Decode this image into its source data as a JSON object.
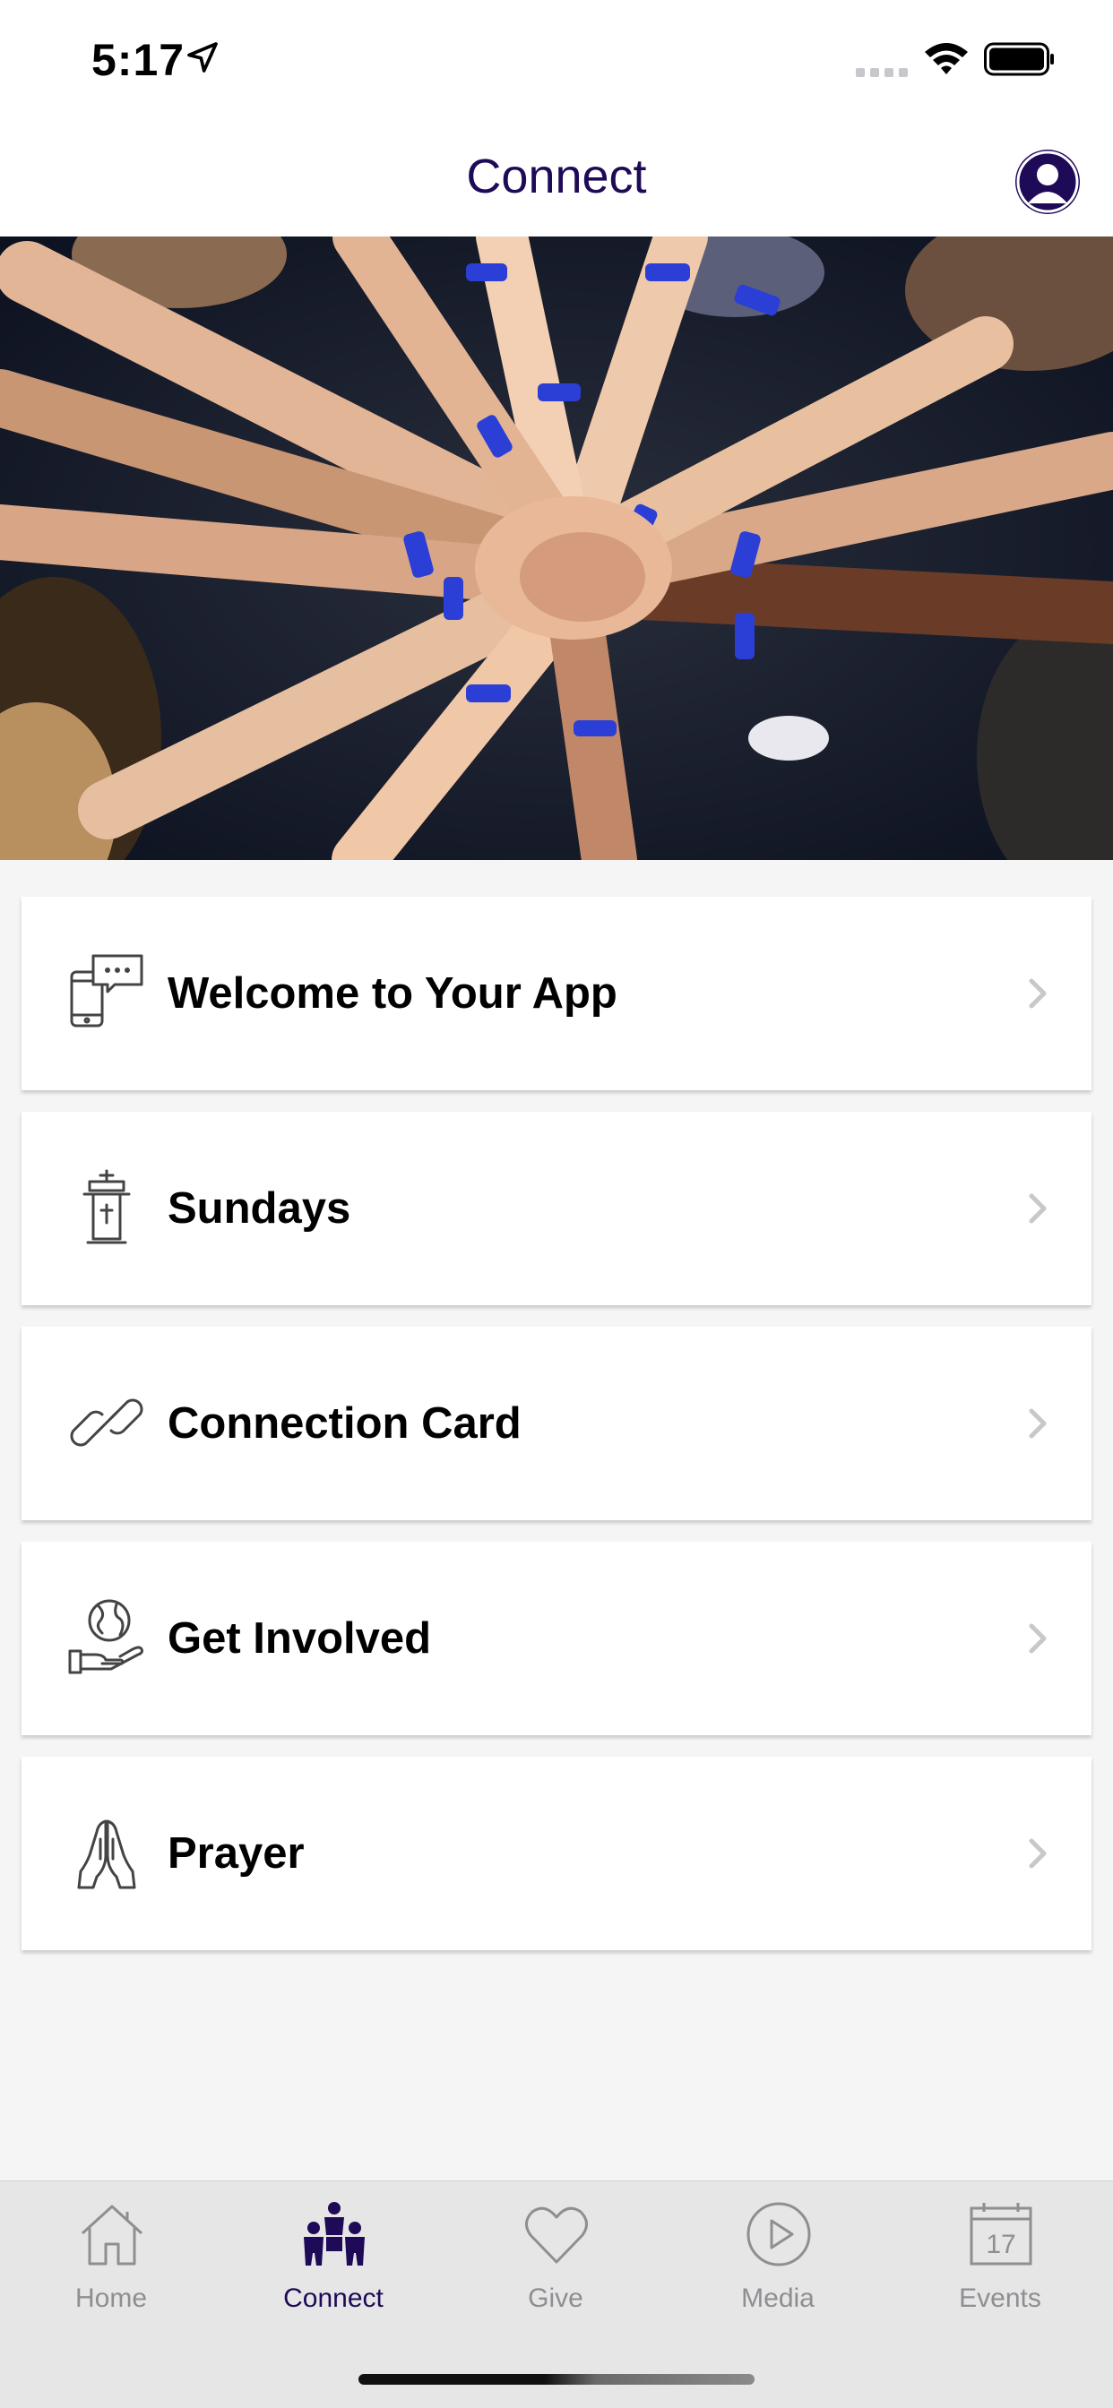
{
  "status_bar": {
    "time": "5:17",
    "icons": [
      "location-arrow-icon",
      "cellular-signal-icon",
      "wifi-icon",
      "battery-icon"
    ]
  },
  "header": {
    "title": "Connect",
    "profile_icon": "user-profile-icon"
  },
  "hero": {
    "image": "team-hands-stacked-photo"
  },
  "menu": {
    "items": [
      {
        "label": "Welcome to Your App",
        "icon": "phone-chat-icon"
      },
      {
        "label": "Sundays",
        "icon": "pulpit-icon"
      },
      {
        "label": "Connection Card",
        "icon": "link-icon"
      },
      {
        "label": "Get Involved",
        "icon": "globe-hand-icon"
      },
      {
        "label": "Prayer",
        "icon": "praying-hands-icon"
      }
    ]
  },
  "tab_bar": {
    "tabs": [
      {
        "label": "Home",
        "icon": "home-icon",
        "active": false
      },
      {
        "label": "Connect",
        "icon": "people-group-icon",
        "active": true
      },
      {
        "label": "Give",
        "icon": "heart-icon",
        "active": false
      },
      {
        "label": "Media",
        "icon": "play-circle-icon",
        "active": false
      },
      {
        "label": "Events",
        "icon": "calendar-icon",
        "active": false
      }
    ],
    "calendar_day": "17"
  },
  "colors": {
    "brand": "#1f0a57",
    "inactive_tab": "#8e8e93",
    "background": "#f5f5f5",
    "tab_bar_bg": "#e6e6e6"
  }
}
